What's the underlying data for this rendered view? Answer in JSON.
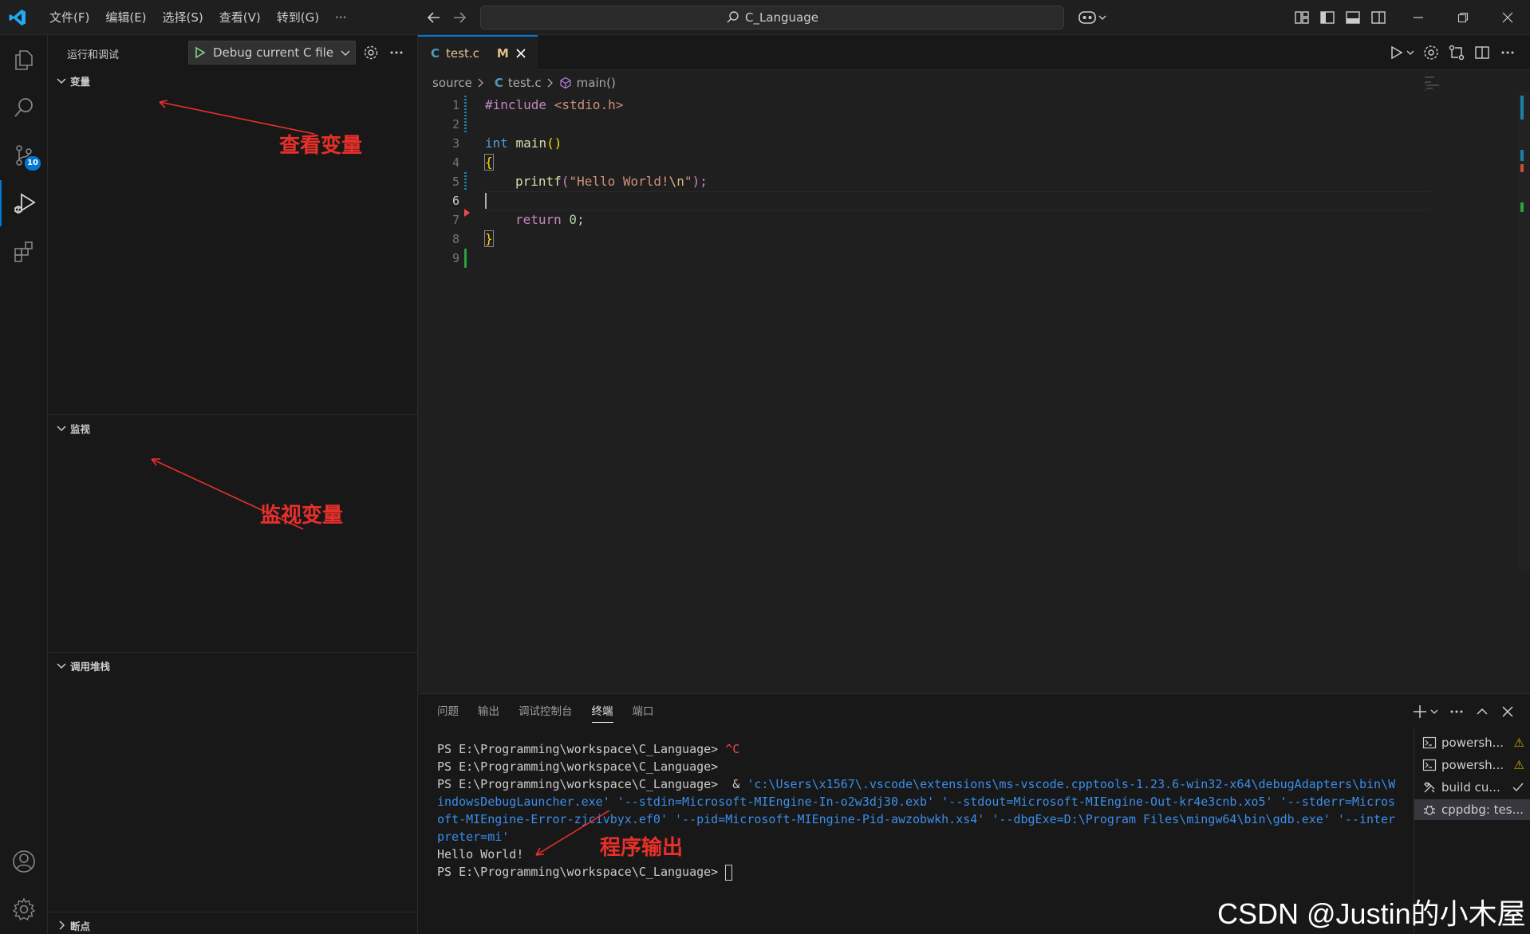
{
  "titlebar": {
    "menu": [
      "文件(F)",
      "编辑(E)",
      "选择(S)",
      "查看(V)",
      "转到(G)",
      "···"
    ],
    "search_text": "C_Language"
  },
  "activitybar": {
    "items": [
      "explorer-icon",
      "search-icon",
      "source-control-icon",
      "run-debug-icon",
      "extensions-icon"
    ],
    "scm_badge": "10",
    "bottom": [
      "account-icon",
      "manage-gear-icon"
    ]
  },
  "sidebar": {
    "title": "运行和调试",
    "debug_config": "Debug current C file",
    "sections": {
      "variables": "变量",
      "watch": "监视",
      "callstack": "调用堆栈",
      "breakpoints": "断点"
    },
    "annotations": {
      "variables_note": "查看变量",
      "watch_note": "监视变量"
    }
  },
  "editor": {
    "tab": {
      "icon": "C",
      "name": "test.c",
      "status": "M"
    },
    "breadcrumb": {
      "folder": "source",
      "file_icon": "C",
      "file": "test.c",
      "symbol": "main()"
    },
    "current_line": 6,
    "line_numbers": [
      "1",
      "2",
      "3",
      "4",
      "5",
      "6",
      "7",
      "8",
      "9"
    ],
    "code": {
      "l1_kw": "#include",
      "l1_rest": " <stdio.h>",
      "l3_type": "int",
      "l3_fn": " main",
      "l3_paren": "()",
      "l4": "{",
      "l5_fn": "printf",
      "l5_open": "(",
      "l5_str": "\"Hello World!",
      "l5_esc": "\\n",
      "l5_strend": "\"",
      "l5_close": ");",
      "l7_kw": "return",
      "l7_num": " 0",
      "l7_end": ";",
      "l8": "}"
    }
  },
  "panel": {
    "tabs": [
      "问题",
      "输出",
      "调试控制台",
      "终端",
      "端口"
    ],
    "active_tab": "终端",
    "terminal": {
      "prompt": "PS E:\\Programming\\workspace\\C_Language> ",
      "ctrl_c": "^C",
      "amp": " & ",
      "cmd1": "'c:\\Users\\x1567\\.vscode\\extensions\\ms-vscode.cpptools-1.23.6-win32-x64\\debugAdapters\\bin\\W",
      "cmd2": "indowsDebugLauncher.exe' '--stdin=Microsoft-MIEngine-In-o2w3dj30.exb' '--stdout=Microsoft-MIEngine-Out-kr4e3cnb.xo5' '--stderr=Micros",
      "cmd3": "oft-MIEngine-Error-zjcivbyx.ef0' '--pid=Microsoft-MIEngine-Pid-awzobwkh.xs4' '--dbgExe=D:\\Program Files\\mingw64\\bin\\gdb.exe' '--inter",
      "cmd4": "preter=mi'",
      "output": "Hello World!",
      "annotation": "程序输出"
    },
    "terminal_list": [
      {
        "name": "powersh...",
        "status": "warning"
      },
      {
        "name": "powersh...",
        "status": "warning"
      },
      {
        "name": "build cu...",
        "status": "done"
      },
      {
        "name": "cppdbg: tes...",
        "status": "active"
      }
    ]
  },
  "watermark": "CSDN @Justin的小木屋",
  "colors": {
    "accent": "#0078d4",
    "annotation_red": "#e8302a",
    "modified": "#e2c08d"
  }
}
